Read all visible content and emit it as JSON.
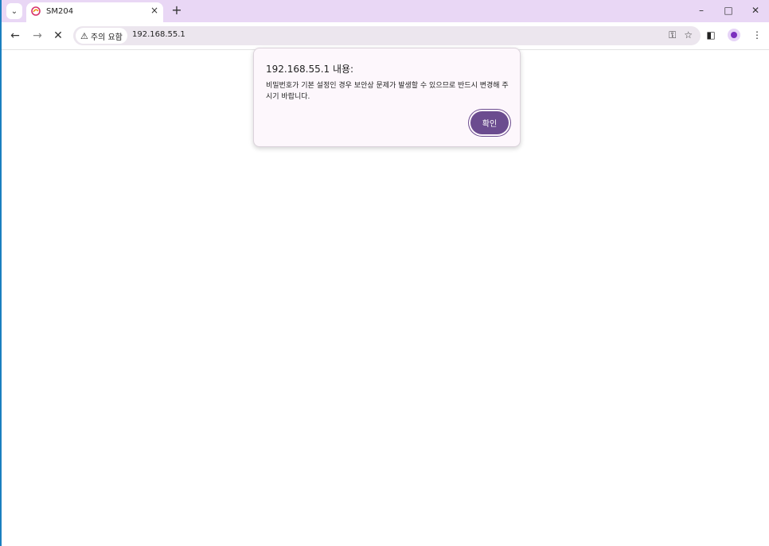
{
  "browser": {
    "tab": {
      "title": "SM204",
      "close_icon": "close-icon",
      "favicon": "swirl-favicon-icon"
    },
    "tab_search_icon": "chevron-down-icon",
    "new_tab_label": "+",
    "window_controls": {
      "minimize": "–",
      "maximize": "□",
      "close": "✕"
    },
    "nav": {
      "back": "←",
      "forward": "→",
      "stop": "✕"
    },
    "omnibox": {
      "security_label": "주의 요함",
      "url": "192.168.55.1"
    },
    "toolbar_icons": [
      "key-icon",
      "star-icon",
      "side-panel-icon",
      "profile-icon",
      "more-menu-icon"
    ]
  },
  "dialog": {
    "title": "192.168.55.1 내용:",
    "message": "비밀번호가 기본 설정인 경우 보안상 문제가 발생할 수 있으므로 반드시 변경해 주시기 바랍니다.",
    "ok_label": "확인"
  },
  "colors": {
    "tabstrip_bg": "#e9d7f5",
    "dialog_bg": "#fdf7fc",
    "dialog_button": "#6b4c8f",
    "profile_accent": "#7b2fbe"
  }
}
